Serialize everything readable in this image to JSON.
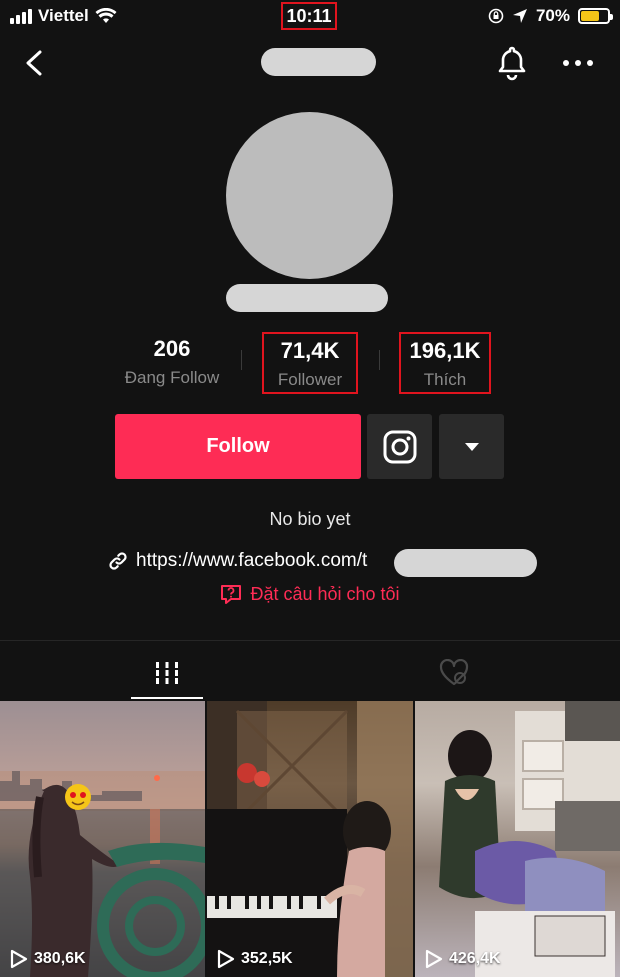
{
  "status_bar": {
    "carrier": "Viettel",
    "time": "10:11",
    "battery": "70%",
    "battery_level": 0.7
  },
  "profile": {
    "stats": [
      {
        "value": "206",
        "label": "Đang Follow"
      },
      {
        "value": "71,4K",
        "label": "Follower"
      },
      {
        "value": "196,1K",
        "label": "Thích"
      }
    ],
    "follow_label": "Follow",
    "bio": "No bio yet",
    "link": "https://www.facebook.com/t",
    "ask_label": "Đặt câu hỏi cho tôi"
  },
  "videos": [
    {
      "views": "380,6K"
    },
    {
      "views": "352,5K"
    },
    {
      "views": "426,4K"
    }
  ],
  "colors": {
    "accent": "#fe2c55",
    "highlight_box": "#e0141e",
    "battery": "#f5c518"
  }
}
